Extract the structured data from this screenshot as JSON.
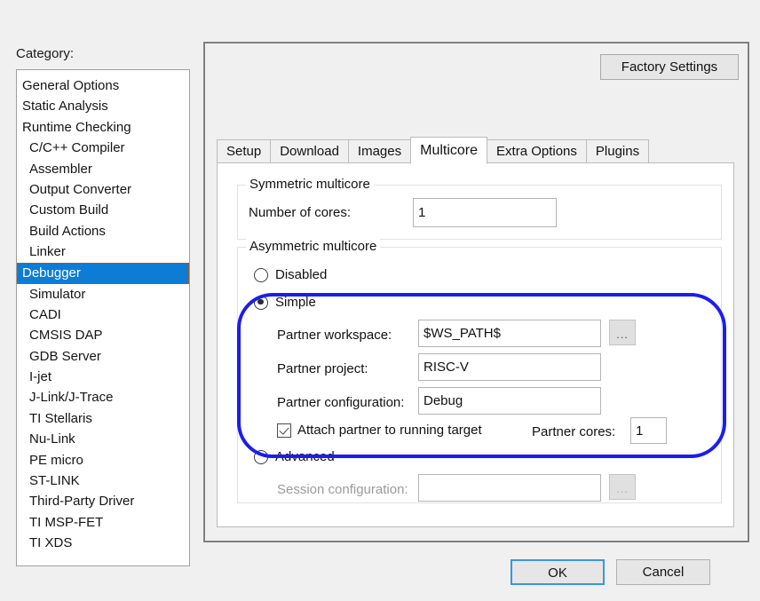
{
  "category": {
    "label": "Category:",
    "items": [
      {
        "label": "General Options",
        "indent": false,
        "selected": false
      },
      {
        "label": "Static Analysis",
        "indent": false,
        "selected": false
      },
      {
        "label": "Runtime Checking",
        "indent": false,
        "selected": false
      },
      {
        "label": "C/C++ Compiler",
        "indent": true,
        "selected": false
      },
      {
        "label": "Assembler",
        "indent": true,
        "selected": false
      },
      {
        "label": "Output Converter",
        "indent": true,
        "selected": false
      },
      {
        "label": "Custom Build",
        "indent": true,
        "selected": false
      },
      {
        "label": "Build Actions",
        "indent": true,
        "selected": false
      },
      {
        "label": "Linker",
        "indent": true,
        "selected": false
      },
      {
        "label": "Debugger",
        "indent": true,
        "selected": true
      },
      {
        "label": "Simulator",
        "indent": true,
        "selected": false
      },
      {
        "label": "CADI",
        "indent": true,
        "selected": false
      },
      {
        "label": "CMSIS DAP",
        "indent": true,
        "selected": false
      },
      {
        "label": "GDB Server",
        "indent": true,
        "selected": false
      },
      {
        "label": "I-jet",
        "indent": true,
        "selected": false
      },
      {
        "label": "J-Link/J-Trace",
        "indent": true,
        "selected": false
      },
      {
        "label": "TI Stellaris",
        "indent": true,
        "selected": false
      },
      {
        "label": "Nu-Link",
        "indent": true,
        "selected": false
      },
      {
        "label": "PE micro",
        "indent": true,
        "selected": false
      },
      {
        "label": "ST-LINK",
        "indent": true,
        "selected": false
      },
      {
        "label": "Third-Party Driver",
        "indent": true,
        "selected": false
      },
      {
        "label": "TI MSP-FET",
        "indent": true,
        "selected": false
      },
      {
        "label": "TI XDS",
        "indent": true,
        "selected": false
      }
    ]
  },
  "toolbar": {
    "factory_settings_label": "Factory Settings"
  },
  "tabs": [
    {
      "label": "Setup",
      "active": false
    },
    {
      "label": "Download",
      "active": false
    },
    {
      "label": "Images",
      "active": false
    },
    {
      "label": "Multicore",
      "active": true
    },
    {
      "label": "Extra Options",
      "active": false
    },
    {
      "label": "Plugins",
      "active": false
    }
  ],
  "symmetric": {
    "group_title": "Symmetric multicore",
    "number_of_cores_label": "Number of cores:",
    "number_of_cores_value": "1"
  },
  "asymmetric": {
    "group_title": "Asymmetric multicore",
    "disabled_label": "Disabled",
    "simple_label": "Simple",
    "advanced_label": "Advanced",
    "selected_mode": "Simple",
    "partner_workspace_label": "Partner workspace:",
    "partner_workspace_value": "$WS_PATH$",
    "partner_project_label": "Partner project:",
    "partner_project_value": "RISC-V",
    "partner_configuration_label": "Partner configuration:",
    "partner_configuration_value": "Debug",
    "attach_partner_label": "Attach partner to running target",
    "attach_partner_checked": true,
    "partner_cores_label": "Partner cores:",
    "partner_cores_value": "1",
    "session_configuration_label": "Session configuration:",
    "session_configuration_value": "",
    "browse_button_label": "...",
    "browse_button_icon": "ellipsis-icon"
  },
  "footer": {
    "ok_label": "OK",
    "cancel_label": "Cancel"
  },
  "annotation": {
    "highlight_color": "#1c1cf0",
    "accent_color": "#0c7cd5"
  }
}
